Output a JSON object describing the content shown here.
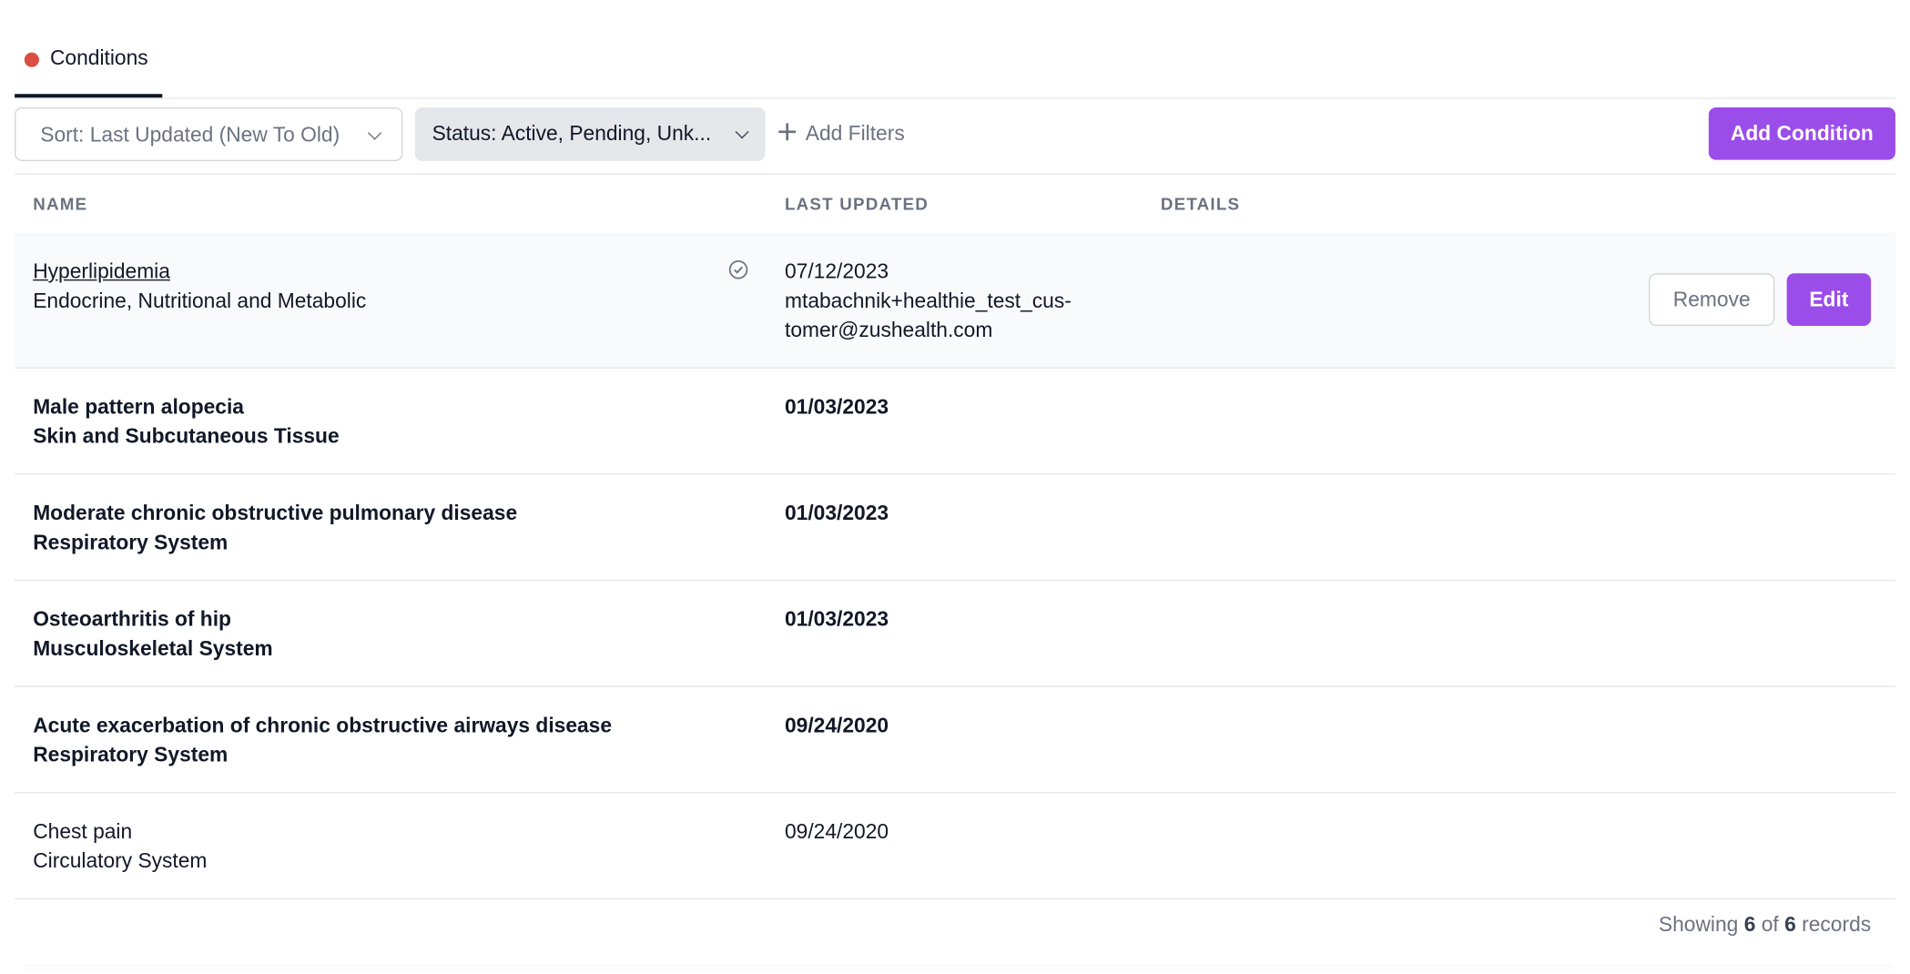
{
  "tabs": {
    "active_label": "Conditions",
    "status_dot_color": "#dc4e41"
  },
  "toolbar": {
    "sort_label": "Sort:",
    "sort_value": "Last Updated (New To Old)",
    "status_label": "Status:",
    "status_value": "Active, Pending, Unk...",
    "add_filters_label": "Add Filters",
    "add_condition_label": "Add Condition",
    "accent_color": "#9b4dea"
  },
  "table": {
    "headers": {
      "name": "NAME",
      "last_updated": "LAST UPDATED",
      "details": "DETAILS"
    },
    "rows": [
      {
        "name": "Hyperlipidemia",
        "category": "Endocrine, Nutritional and Metabolic",
        "date": "07/12/2023",
        "updated_by_line1": "mtabachnik+healthie_test_cus-",
        "updated_by_line2": "tomer@zushealth.com",
        "remove_label": "Remove",
        "edit_label": "Edit"
      },
      {
        "name": "Male pattern alopecia",
        "category": "Skin and Subcutaneous Tissue",
        "date": "01/03/2023"
      },
      {
        "name": "Moderate chronic obstructive pulmonary disease",
        "category": "Respiratory System",
        "date": "01/03/2023"
      },
      {
        "name": "Osteoarthritis of hip",
        "category": "Musculoskeletal System",
        "date": "01/03/2023"
      },
      {
        "name": "Acute exacerbation of chronic obstructive airways disease",
        "category": "Respiratory System",
        "date": "09/24/2020"
      },
      {
        "name": "Chest pain",
        "category": "Circulatory System",
        "date": "09/24/2020"
      }
    ]
  },
  "footer": {
    "showing": "Showing",
    "shown": "6",
    "of": "of",
    "total": "6",
    "records": "records"
  }
}
